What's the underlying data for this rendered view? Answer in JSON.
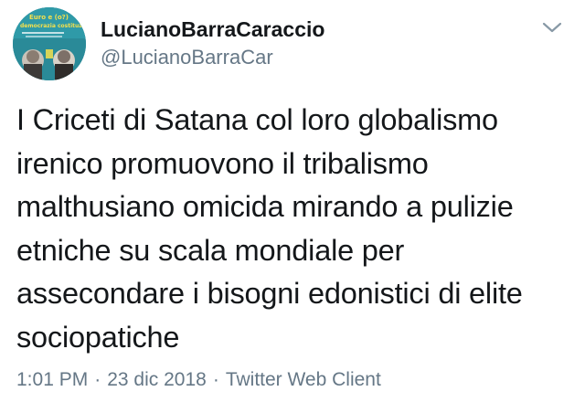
{
  "user": {
    "display_name": "LucianoBarraCaraccio",
    "handle": "@LucianoBarraCar",
    "avatar_text": [
      "Euro e (o?)",
      "democrazia costituzionale"
    ]
  },
  "tweet": {
    "lines": [
      "I Criceti di Satana col loro globalismo",
      "irenico promuovono il tribalismo",
      "malthusiano omicida mirando a pulizie",
      "etniche su scala mondiale per",
      "assecondare i bisogni edonistici di elite",
      "sociopatiche"
    ],
    "time": "1:01 PM",
    "date": "23 dic 2018",
    "separator": "·",
    "client": "Twitter Web Client"
  },
  "icons": {
    "chevron": "chevron-down-icon",
    "avatar": "avatar-image"
  },
  "colors": {
    "text": "#14171a",
    "muted": "#657786",
    "avatar_bg": "#2a8a98"
  }
}
